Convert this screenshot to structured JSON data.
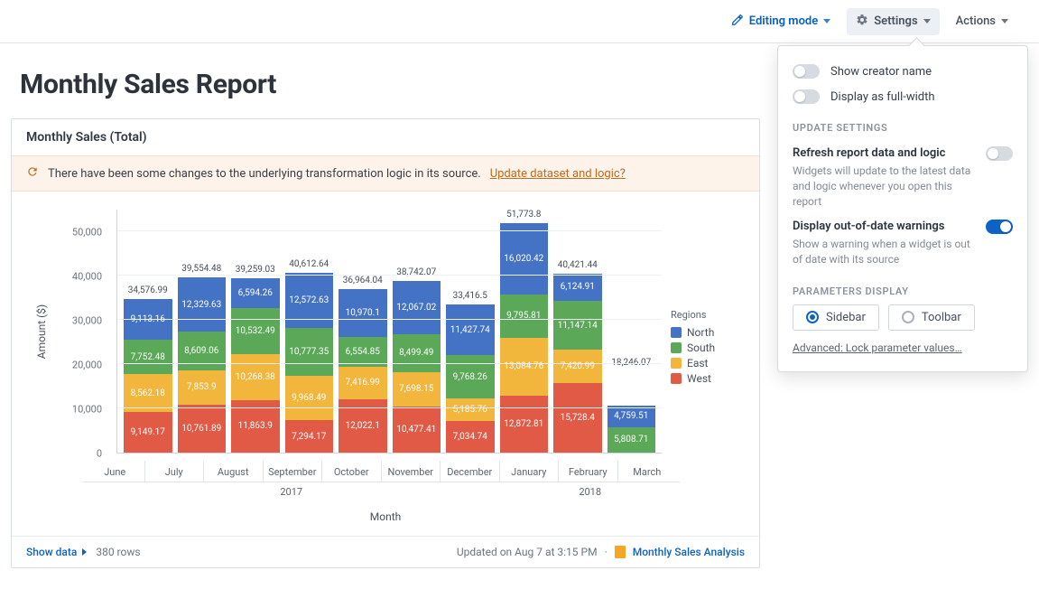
{
  "toolbar": {
    "editing_mode": "Editing mode",
    "settings": "Settings",
    "actions": "Actions"
  },
  "page_title": "Monthly Sales Report",
  "card": {
    "title": "Monthly Sales (Total)",
    "notice_text": "There have been some changes to the underlying transformation logic in its source.",
    "notice_link": "Update dataset and logic?",
    "footer": {
      "show_data": "Show data",
      "rows": "380 rows",
      "updated": "Updated on Aug 7 at 3:15 PM",
      "analysis_link": "Monthly Sales Analysis"
    }
  },
  "settings_panel": {
    "show_creator": "Show creator name",
    "full_width": "Display as full-width",
    "update_head": "UPDATE SETTINGS",
    "refresh_title": "Refresh report data and logic",
    "refresh_desc": "Widgets will update to the latest data and logic whenever you open this report",
    "ood_title": "Display out-of-date warnings",
    "ood_desc": "Show a warning when a widget is out of date with its source",
    "params_head": "PARAMETERS DISPLAY",
    "sidebar": "Sidebar",
    "toolbar": "Toolbar",
    "advanced": "Advanced: Lock parameter values…"
  },
  "chart_data": {
    "type": "bar",
    "stacked": true,
    "title": "Monthly Sales (Total)",
    "xlabel": "Month",
    "ylabel": "Amount ($)",
    "ylim": [
      0,
      55000
    ],
    "yticks": [
      0,
      10000,
      20000,
      30000,
      40000,
      50000
    ],
    "ytick_labels": [
      "0",
      "10,000",
      "20,000",
      "30,000",
      "40,000",
      "50,000"
    ],
    "legend_title": "Regions",
    "categories": [
      "June",
      "July",
      "August",
      "September",
      "October",
      "November",
      "December",
      "January",
      "February",
      "March"
    ],
    "year_groups": [
      {
        "label": "2017",
        "span": 7
      },
      {
        "label": "2018",
        "span": 3
      }
    ],
    "series": [
      {
        "name": "West",
        "color": "#e15a45",
        "values": [
          9149.17,
          10761.89,
          11863.9,
          7294.17,
          12022.1,
          10477.41,
          7034.74,
          12872.81,
          15728.4,
          null
        ]
      },
      {
        "name": "East",
        "color": "#f2b63c",
        "values": [
          8562.18,
          7853.9,
          10268.38,
          9968.49,
          7416.99,
          7698.15,
          5185.76,
          13084.76,
          7420.99,
          null
        ]
      },
      {
        "name": "South",
        "color": "#5aa858",
        "values": [
          7752.48,
          8609.06,
          10532.49,
          10777.35,
          6554.85,
          8499.49,
          9768.26,
          9795.81,
          11147.14,
          5808.71
        ]
      },
      {
        "name": "North",
        "color": "#4472c4",
        "values": [
          9113.16,
          12329.63,
          6594.26,
          12572.63,
          10970.1,
          12067.02,
          11427.74,
          16020.42,
          6124.91,
          4759.51
        ]
      }
    ],
    "totals": [
      34576.99,
      39554.48,
      39259.03,
      40612.64,
      36964.04,
      38742.07,
      33416.5,
      51773.8,
      40421.44,
      18246.07
    ],
    "legend_order": [
      "North",
      "South",
      "East",
      "West"
    ]
  }
}
